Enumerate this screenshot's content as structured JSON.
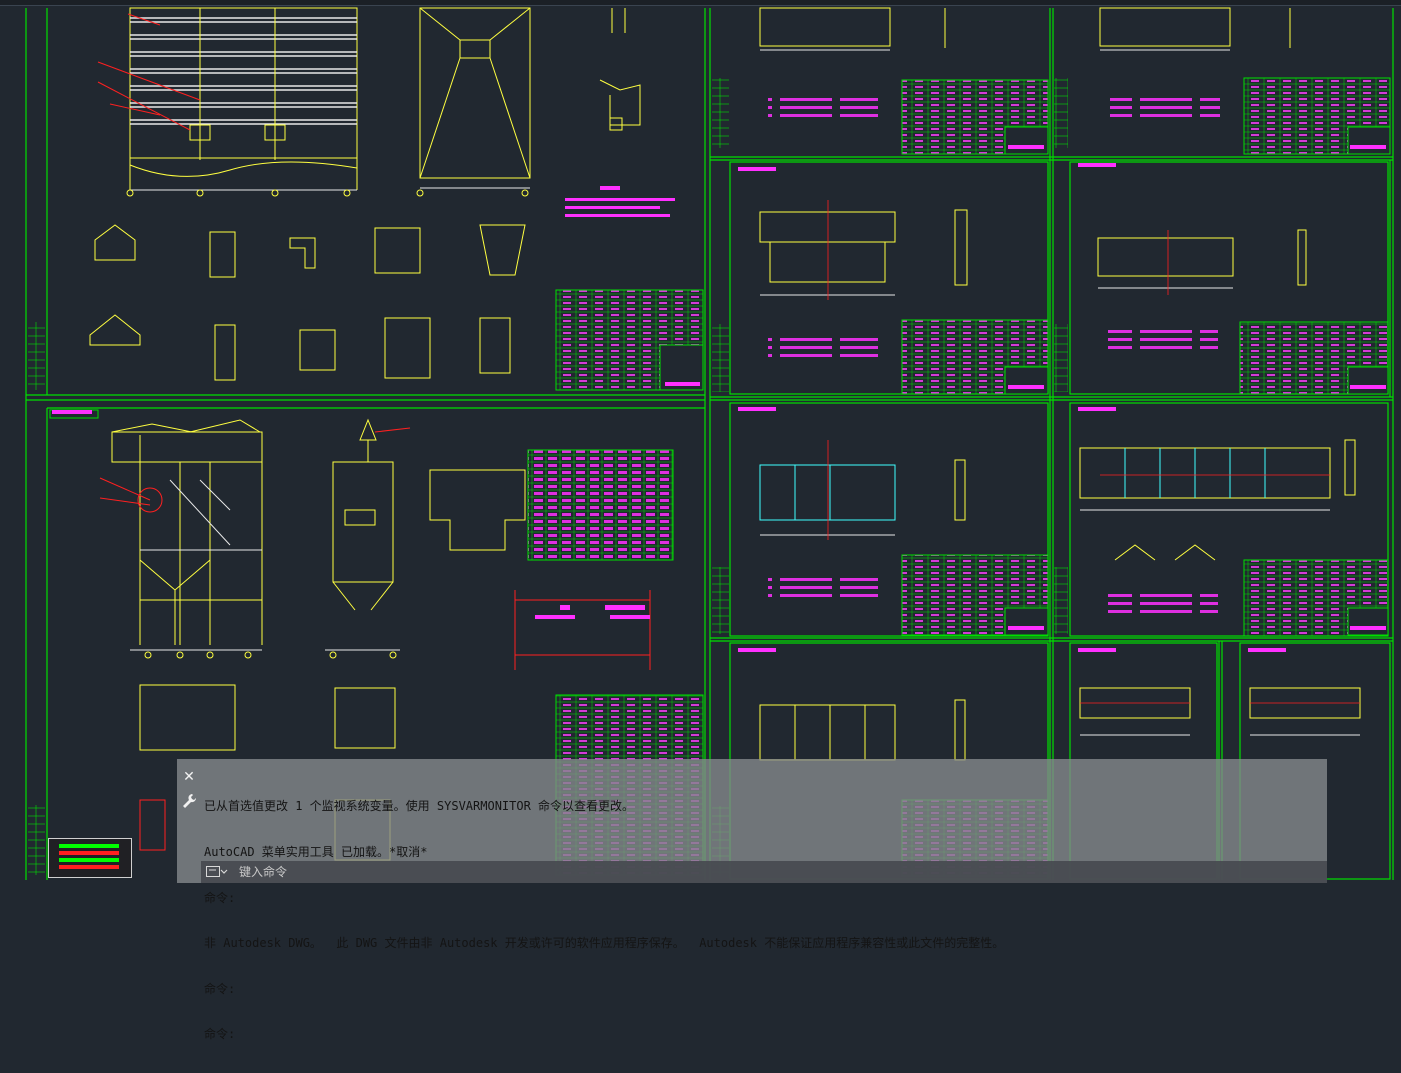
{
  "command_line": {
    "history": [
      "已从首选值更改 1 个监视系统变量。使用 SYSVARMONITOR 命令以查看更改。",
      "AutoCAD 菜单实用工具 已加载。*取消*",
      "命令:",
      "非 Autodesk DWG。  此 DWG 文件由非 Autodesk 开发或许可的软件应用程序保存。  Autodesk 不能保证应用程序兼容性或此文件的完整性。",
      "命令:",
      "命令:"
    ],
    "input_placeholder": "键入命令",
    "close_icon": "close-icon",
    "customize_icon": "wrench-icon",
    "prompt_icon": "command-prompt-icon"
  },
  "drawing": {
    "background_color": "#212830",
    "colors": {
      "frame": "#00e000",
      "geometry": "#ffff40",
      "notes": "#ff30ff",
      "dims": "#e8e8e8",
      "center": "#ff2020",
      "cyan": "#40ffff"
    }
  },
  "navigation_widget": {
    "icon": "navigation-bar-icon",
    "colors": [
      "#00ff00",
      "#ff2020",
      "#00ff00",
      "#ff2020"
    ]
  }
}
